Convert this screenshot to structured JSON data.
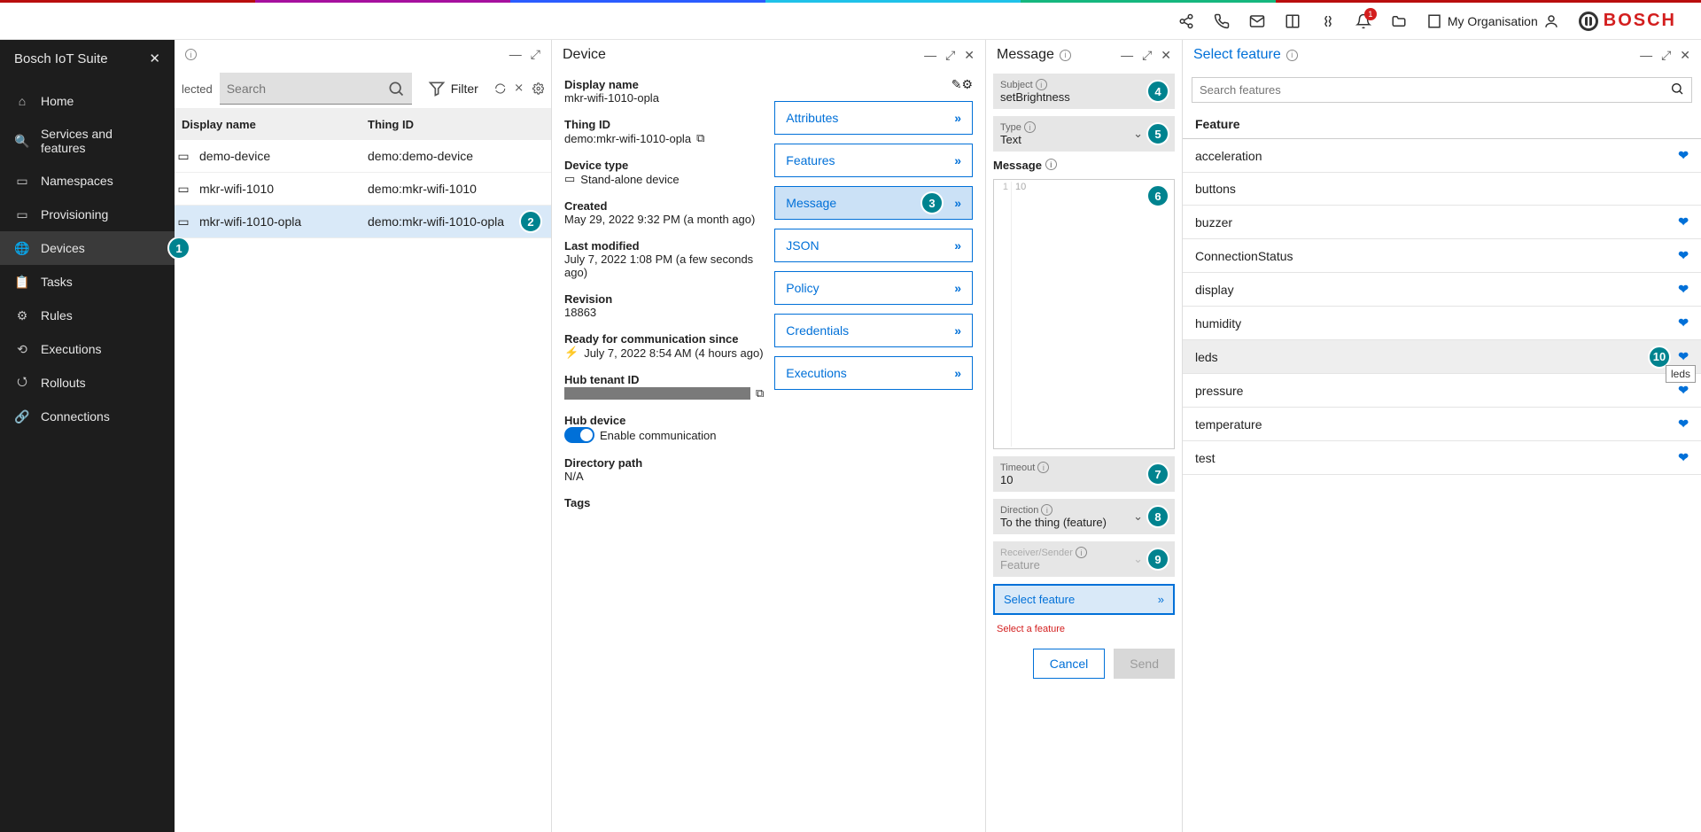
{
  "topbar": {
    "notification_count": "1",
    "org_label": "My Organisation",
    "brand": "BOSCH"
  },
  "sidebar": {
    "title": "Bosch IoT Suite",
    "items": [
      {
        "label": "Home"
      },
      {
        "label": "Services and features"
      },
      {
        "label": "Namespaces"
      },
      {
        "label": "Provisioning"
      },
      {
        "label": "Devices",
        "active": true,
        "step": "1"
      },
      {
        "label": "Tasks"
      },
      {
        "label": "Rules"
      },
      {
        "label": "Executions"
      },
      {
        "label": "Rollouts"
      },
      {
        "label": "Connections"
      }
    ]
  },
  "things": {
    "selected_label": "lected",
    "search_placeholder": "Search",
    "filter_label": "Filter",
    "columns": {
      "display": "Display name",
      "thing_id": "Thing ID"
    },
    "rows": [
      {
        "display": "demo-device",
        "id": "demo:demo-device"
      },
      {
        "display": "mkr-wifi-1010",
        "id": "demo:mkr-wifi-1010"
      },
      {
        "display": "mkr-wifi-1010-opla",
        "id": "demo:mkr-wifi-1010-opla",
        "selected": true,
        "step": "2"
      }
    ]
  },
  "device": {
    "title": "Device",
    "display_name_label": "Display name",
    "display_name": "mkr-wifi-1010-opla",
    "thing_id_label": "Thing ID",
    "thing_id": "demo:mkr-wifi-1010-opla",
    "type_label": "Device type",
    "type": "Stand-alone device",
    "created_label": "Created",
    "created": "May 29, 2022 9:32 PM (a month ago)",
    "modified_label": "Last modified",
    "modified": "July 7, 2022 1:08 PM (a few seconds ago)",
    "revision_label": "Revision",
    "revision": "18863",
    "ready_label": "Ready for communication since",
    "ready": "July 7, 2022 8:54 AM (4 hours ago)",
    "hub_tenant_label": "Hub tenant ID",
    "hub_device_label": "Hub device",
    "enable_comm": "Enable communication",
    "dirpath_label": "Directory path",
    "dirpath": "N/A",
    "tags_label": "Tags",
    "cards": [
      {
        "label": "Attributes"
      },
      {
        "label": "Features"
      },
      {
        "label": "Message",
        "active": true,
        "step": "3"
      },
      {
        "label": "JSON"
      },
      {
        "label": "Policy"
      },
      {
        "label": "Credentials"
      },
      {
        "label": "Executions"
      }
    ]
  },
  "message": {
    "title": "Message",
    "subject_label": "Subject",
    "subject": "setBrightness",
    "subject_step": "4",
    "type_label": "Type",
    "type": "Text",
    "type_step": "5",
    "msg_label": "Message",
    "msg_gutter": "1",
    "msg_placeholder": "10",
    "msg_step": "6",
    "timeout_label": "Timeout",
    "timeout": "10",
    "timeout_step": "7",
    "direction_label": "Direction",
    "direction": "To the thing (feature)",
    "direction_step": "8",
    "receiver_label": "Receiver/Sender",
    "receiver": "Feature",
    "receiver_step": "9",
    "select_feature": "Select feature",
    "error": "Select a feature",
    "cancel": "Cancel",
    "send": "Send"
  },
  "features": {
    "title": "Select feature",
    "search_placeholder": "Search features",
    "heading": "Feature",
    "items": [
      {
        "name": "acceleration"
      },
      {
        "name": "buttons",
        "noicon": true
      },
      {
        "name": "buzzer"
      },
      {
        "name": "ConnectionStatus"
      },
      {
        "name": "display"
      },
      {
        "name": "humidity"
      },
      {
        "name": "leds",
        "selected": true,
        "step": "10",
        "tooltip": "leds"
      },
      {
        "name": "pressure"
      },
      {
        "name": "temperature"
      },
      {
        "name": "test"
      }
    ]
  }
}
